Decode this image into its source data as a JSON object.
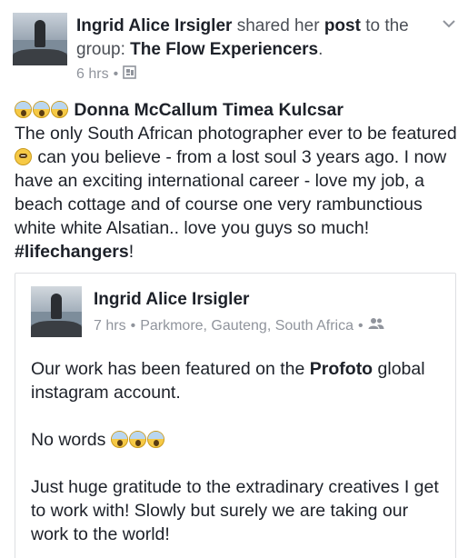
{
  "post": {
    "author": "Ingrid Alice Irsigler",
    "shared_her": "shared her",
    "post_word": "post",
    "to_the_group": "to the group:",
    "group_name": "The Flow Experiencers",
    "period": ".",
    "time": "6 hrs",
    "dot": "•",
    "mentions": "Donna McCallum Timea Kulcsar",
    "body_part1": "The only South African photographer ever to be featured",
    "body_part2": "can you believe - from a lost soul 3 years ago. I now have an exciting international career - love my job, a beach cottage and of course one very rambunctious white white Alsatian..  love you guys so much!",
    "hashtag": "#lifechangers",
    "body_end": "!"
  },
  "shared": {
    "author": "Ingrid Alice Irsigler",
    "time": "7 hrs",
    "dot": "•",
    "location": "Parkmore, Gauteng, South Africa",
    "dot2": "•",
    "para1_a": "Our work has been featured on the",
    "para1_bold": "Profoto",
    "para1_b": "global instagram account.",
    "para2": "No words",
    "para3": "Just huge gratitude to the extradinary creatives I get to work with! Slowly but surely we are taking our work to the world!"
  },
  "icons": {
    "chevron": "chevron-down-icon",
    "audience_group": "group-privacy-icon",
    "audience_friends": "friends-icon",
    "emoji_scream": "face-screaming-emoji",
    "emoji_flushed": "flushed-face-emoji"
  },
  "colors": {
    "text": "#1d2129",
    "secondary": "#90949c",
    "header_gray": "#4b4f56",
    "border": "#dddfe2"
  }
}
